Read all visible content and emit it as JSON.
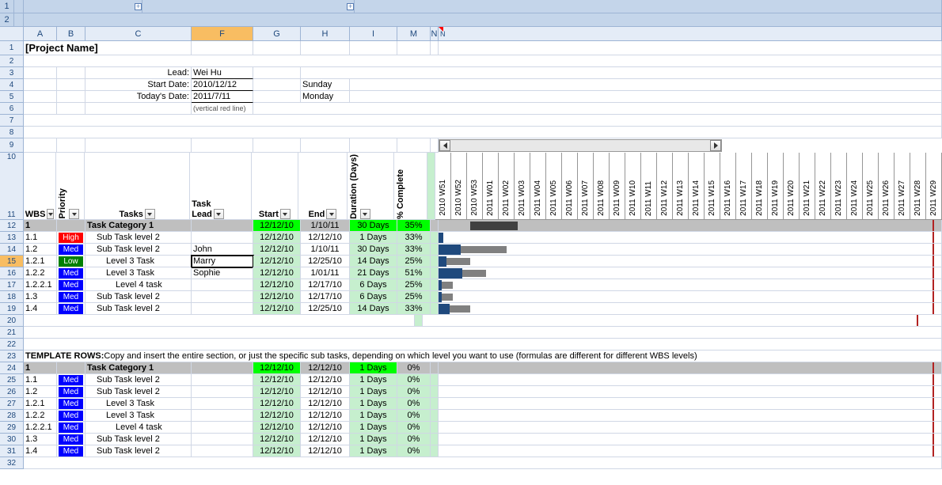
{
  "project_name": "[Project Name]",
  "labels": {
    "lead": "Lead:",
    "start": "Start Date:",
    "today": "Today's Date:",
    "note": "(vertical red line)"
  },
  "values": {
    "lead": "Wei Hu",
    "start": "2010/12/12",
    "start_day": "Sunday",
    "today": "2011/7/11",
    "today_day": "Monday"
  },
  "headers": {
    "wbs": "WBS",
    "priority": "Priority",
    "tasks": "Tasks",
    "tasklead": "Task Lead",
    "start": "Start",
    "end": "End",
    "duration": "Duration (Days)",
    "complete": "% Complete"
  },
  "cols": [
    "A",
    "B",
    "C",
    "F",
    "G",
    "H",
    "I",
    "M",
    "N"
  ],
  "weeks": [
    "2010 W51",
    "2010 W52",
    "2010 W53",
    "2011 W01",
    "2011 W02",
    "2011 W03",
    "2011 W04",
    "2011 W05",
    "2011 W06",
    "2011 W07",
    "2011 W08",
    "2011 W09",
    "2011 W10",
    "2011 W11",
    "2011 W12",
    "2011 W13",
    "2011 W14",
    "2011 W15",
    "2011 W16",
    "2011 W17",
    "2011 W18",
    "2011 W19",
    "2011 W20",
    "2011 W21",
    "2011 W22",
    "2011 W23",
    "2011 W24",
    "2011 W25",
    "2011 W26",
    "2011 W27",
    "2011 W28",
    "2011 W29"
  ],
  "rows": [
    {
      "n": 12,
      "cat": true,
      "wbs": "1",
      "task": "Task Category 1",
      "start": "12/12/10",
      "end": "1/10/11",
      "dur": "30 Days",
      "pct": "35%",
      "pc": "bg-green",
      "bar": {
        "type": "cat",
        "from": 2,
        "to": 5
      }
    },
    {
      "n": 13,
      "wbs": "1.1",
      "pri": "High",
      "task": "Sub Task level 2",
      "start": "12/12/10",
      "end": "12/12/10",
      "dur": "1 Days",
      "pct": "33%",
      "bar": {
        "d": 0.3,
        "r": 0
      }
    },
    {
      "n": 14,
      "wbs": "1.2",
      "pri": "Med",
      "task": "Sub Task level 2",
      "lead": "John",
      "start": "12/12/10",
      "end": "1/10/11",
      "dur": "30 Days",
      "pct": "33%",
      "bar": {
        "d": 1.4,
        "r": 4.3
      }
    },
    {
      "n": 15,
      "active": true,
      "wbs": "1.2.1",
      "pri": "Low",
      "task": "Level 3 Task",
      "lead": "Marry",
      "start": "12/12/10",
      "end": "12/25/10",
      "dur": "14 Days",
      "pct": "25%",
      "bar": {
        "d": 0.5,
        "r": 2
      }
    },
    {
      "n": 16,
      "wbs": "1.2.2",
      "pri": "Med",
      "task": "Level 3 Task",
      "lead": "Sophie",
      "start": "12/12/10",
      "end": "1/01/11",
      "dur": "21 Days",
      "pct": "51%",
      "bar": {
        "d": 1.5,
        "r": 3
      }
    },
    {
      "n": 17,
      "wbs": "1.2.2.1",
      "pri": "Med",
      "task": "Level 4 task",
      "start": "12/12/10",
      "end": "12/17/10",
      "dur": "6 Days",
      "pct": "25%",
      "bar": {
        "d": 0.2,
        "r": 0.9
      }
    },
    {
      "n": 18,
      "wbs": "1.3",
      "pri": "Med",
      "task": "Sub Task level 2",
      "start": "12/12/10",
      "end": "12/17/10",
      "dur": "6 Days",
      "pct": "25%",
      "bar": {
        "d": 0.2,
        "r": 0.9
      }
    },
    {
      "n": 19,
      "wbs": "1.4",
      "pri": "Med",
      "task": "Sub Task level 2",
      "start": "12/12/10",
      "end": "12/25/10",
      "dur": "14 Days",
      "pct": "33%",
      "bar": {
        "d": 0.7,
        "r": 2
      }
    }
  ],
  "template_note": {
    "b": "TEMPLATE ROWS: ",
    "t": "Copy and insert the entire section, or just the specific sub tasks, depending on which level you want to use (formulas are different for different WBS levels)"
  },
  "trows": [
    {
      "n": 24,
      "cat": true,
      "wbs": "1",
      "task": "Task Category 1",
      "start": "12/12/10",
      "end": "12/12/10",
      "dur": "1 Days",
      "pct": "0%"
    },
    {
      "n": 25,
      "wbs": "1.1",
      "pri": "Med",
      "task": "Sub Task level 2",
      "start": "12/12/10",
      "end": "12/12/10",
      "dur": "1 Days",
      "pct": "0%"
    },
    {
      "n": 26,
      "wbs": "1.2",
      "pri": "Med",
      "task": "Sub Task level 2",
      "start": "12/12/10",
      "end": "12/12/10",
      "dur": "1 Days",
      "pct": "0%"
    },
    {
      "n": 27,
      "wbs": "1.2.1",
      "pri": "Med",
      "task": "Level 3 Task",
      "start": "12/12/10",
      "end": "12/12/10",
      "dur": "1 Days",
      "pct": "0%"
    },
    {
      "n": 28,
      "wbs": "1.2.2",
      "pri": "Med",
      "task": "Level 3 Task",
      "start": "12/12/10",
      "end": "12/12/10",
      "dur": "1 Days",
      "pct": "0%"
    },
    {
      "n": 29,
      "wbs": "1.2.2.1",
      "pri": "Med",
      "task": "Level 4 task",
      "start": "12/12/10",
      "end": "12/12/10",
      "dur": "1 Days",
      "pct": "0%"
    },
    {
      "n": 30,
      "wbs": "1.3",
      "pri": "Med",
      "task": "Sub Task level 2",
      "start": "12/12/10",
      "end": "12/12/10",
      "dur": "1 Days",
      "pct": "0%"
    },
    {
      "n": 31,
      "wbs": "1.4",
      "pri": "Med",
      "task": "Sub Task level 2",
      "start": "12/12/10",
      "end": "12/12/10",
      "dur": "1 Days",
      "pct": "0%"
    }
  ]
}
